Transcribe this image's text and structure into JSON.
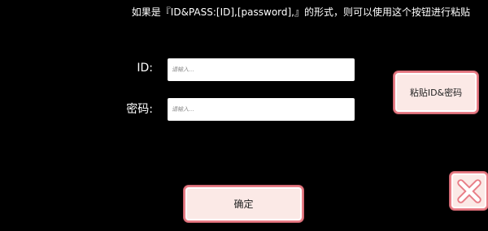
{
  "hint": {
    "text": "如果是『ID&PASS:[ID],[password],』的形式，则可以使用这个按钮进行粘贴"
  },
  "form": {
    "id_label": "ID:",
    "password_label": "密码:",
    "id_placeholder": "请输入...",
    "password_placeholder": "请输入...",
    "id_value": "",
    "password_value": ""
  },
  "buttons": {
    "paste_label": "粘贴ID&密码",
    "confirm_label": "确定",
    "close_icon": "close-x-icon"
  },
  "colors": {
    "background": "#000000",
    "button_fill": "#fbe9e6",
    "button_border": "#e87d86",
    "close_x": "#ffffff"
  }
}
